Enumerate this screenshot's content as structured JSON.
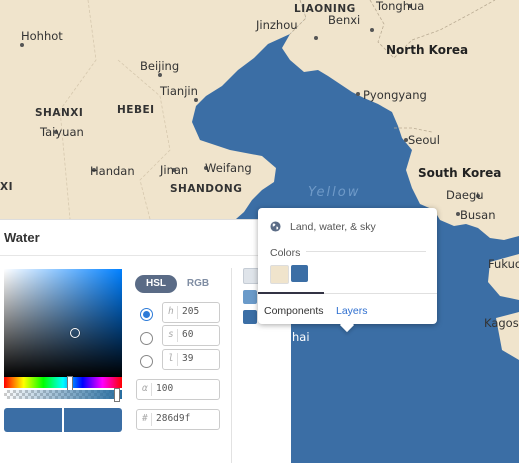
{
  "map": {
    "labels": {
      "liaoning": "LIAONING",
      "tonghua": "Tonghua",
      "jinzhou": "Jinzhou",
      "benxi": "Benxi",
      "hohhot": "Hohhot",
      "north_korea": "North Korea",
      "beijing": "Beijing",
      "tianjin": "Tianjin",
      "pyongyang": "Pyongyang",
      "shanxi": "SHANXI",
      "hebei": "HEBEI",
      "taiyuan": "Taiyuan",
      "seoul": "Seoul",
      "handan": "Handan",
      "jinan": "Jinan",
      "weifang": "Weifang",
      "south_korea": "South Korea",
      "shandong": "SHANDONG",
      "yellow": "Yellow",
      "daegu": "Daegu",
      "busan": "Busan",
      "xi": "XI",
      "fukuo": "Fukuo",
      "kagosh": "Kagosh",
      "hai": "hai"
    },
    "colors": {
      "land": "#f0e4cc",
      "water": "#3b6ea5"
    }
  },
  "panel": {
    "title": "Water",
    "tabs": {
      "hsl": "HSL",
      "rgb": "RGB"
    },
    "fields": {
      "h": {
        "label": "h",
        "value": "205"
      },
      "s": {
        "label": "s",
        "value": "60"
      },
      "l": {
        "label": "l",
        "value": "39"
      },
      "alpha": {
        "label": "α",
        "value": "100"
      },
      "hex": {
        "label": "#",
        "value": "286d9f"
      }
    },
    "selected_mode": "h",
    "current_color": "#286d9f"
  },
  "popover": {
    "header": "Land, water, & sky",
    "colors_label": "Colors",
    "swatches": [
      "#f0e4cc",
      "#3b6ea5"
    ],
    "tabs": {
      "components": "Components",
      "layers": "Layers"
    },
    "active_tab": "Components"
  }
}
